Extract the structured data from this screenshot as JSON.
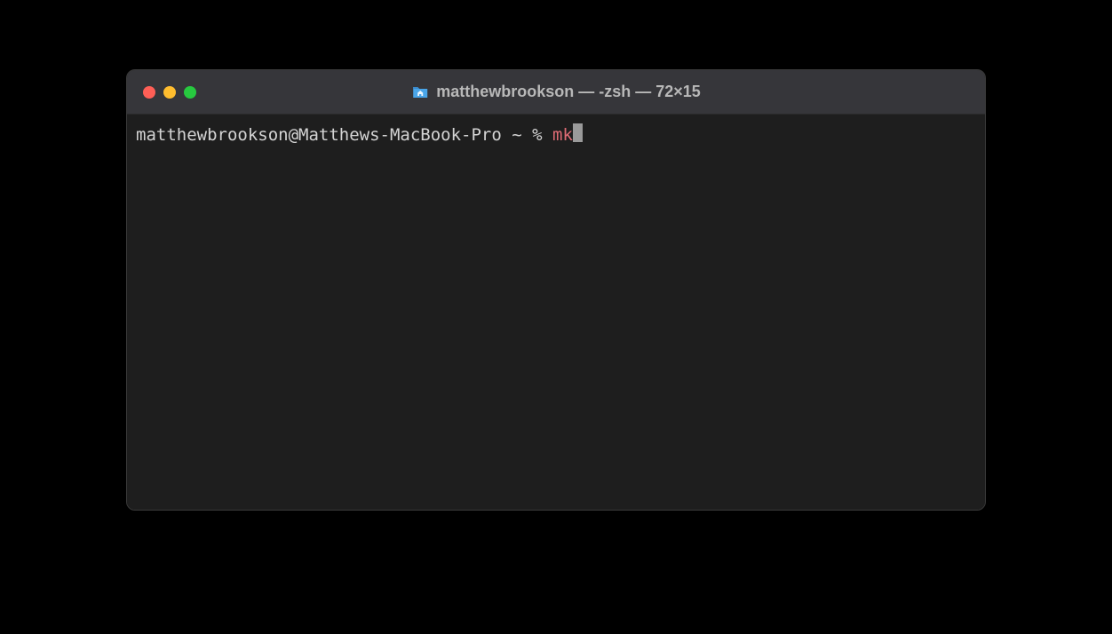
{
  "window": {
    "title": "matthewbrookson — -zsh — 72×15",
    "folder_icon": "home-folder-icon"
  },
  "terminal": {
    "prompt": "matthewbrookson@Matthews-MacBook-Pro ~ % ",
    "command": "mk"
  },
  "colors": {
    "bg": "#1e1e1e",
    "titlebar": "#36363a",
    "text": "#d4d4d4",
    "command": "#e06c75",
    "cursor": "#9a9a9a"
  }
}
